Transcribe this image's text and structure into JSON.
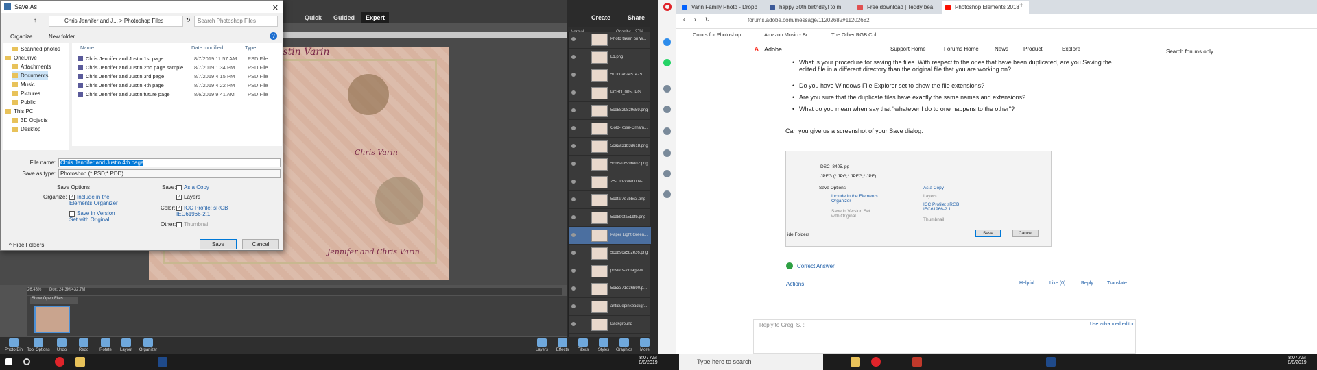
{
  "pse": {
    "modes": [
      "Quick",
      "Guided",
      "Expert"
    ],
    "create_label": "Create",
    "share_label": "Share",
    "doc_titles": [
      "and Justin Varin",
      "Chris Varin",
      "Jennifer and Chris Varin"
    ],
    "zoom_status": "26.43%",
    "doc_size": "Doc: 24.3M/432.7M",
    "show_open_files": "Show Open Files",
    "opacity_label": "Opacity:",
    "opacity_value": "37%",
    "blend_mode": "Normal",
    "bottom_tools": [
      "Photo Bin",
      "Tool Options",
      "Undo",
      "Redo",
      "Rotate",
      "Layout",
      "Organizer"
    ],
    "bottom_right": [
      "Layers",
      "Effects",
      "Filters",
      "Styles",
      "Graphics",
      "More"
    ],
    "layers": [
      {
        "name": "Photo taken on W..."
      },
      {
        "name": "L1.png"
      },
      {
        "name": "5f1fcdac2451475..."
      },
      {
        "name": "PCHO_005.JPG"
      },
      {
        "name": "5c95829829c59.png"
      },
      {
        "name": "Gold-Rose-Ornam..."
      },
      {
        "name": "5ca2a31b3d618.png"
      },
      {
        "name": "5cd8a089968d2.png"
      },
      {
        "name": "25-Old-Valentine-..."
      },
      {
        "name": "5cdfaf7e7bbc3.png"
      },
      {
        "name": "5cd8b0fa51bfb.png"
      },
      {
        "name": "Paper Light Green..."
      },
      {
        "name": "5cd89ca5b2e36.png"
      },
      {
        "name": "posters-vintage-w..."
      },
      {
        "name": "5c53371d36b90.p..."
      },
      {
        "name": "antiquepinkbackgr..."
      },
      {
        "name": "Background"
      }
    ]
  },
  "dialog": {
    "title": "Save As",
    "path": "Chris Jennifer and J...  >  Photoshop Files",
    "search_placeholder": "Search Photoshop Files",
    "organize": "Organize",
    "new_folder": "New folder",
    "tree": [
      "Scanned photos",
      "OneDrive",
      "Attachments",
      "Documents",
      "Music",
      "Pictures",
      "Public",
      "This PC",
      "3D Objects",
      "Desktop"
    ],
    "columns": [
      "Name",
      "Date modified",
      "Type"
    ],
    "files": [
      {
        "name": "Chris Jennifer and Justin 1st page",
        "date": "8/7/2019 11:57 AM",
        "type": "PSD File"
      },
      {
        "name": "Chris Jennifer and Justin 2nd page sample",
        "date": "8/7/2019 1:34 PM",
        "type": "PSD File"
      },
      {
        "name": "Chris Jennifer and Justin 3rd page",
        "date": "8/7/2019 4:15 PM",
        "type": "PSD File"
      },
      {
        "name": "Chris Jennifer and Justin 4th page",
        "date": "8/7/2019 4:22 PM",
        "type": "PSD File"
      },
      {
        "name": "Chris Jennifer and Justin future page",
        "date": "8/6/2019 9:41 AM",
        "type": "PSD File"
      }
    ],
    "file_name_label": "File name:",
    "file_name_value": "Chris Jennifer and Justin 4th page",
    "save_type_label": "Save as type:",
    "save_type_value": "Photoshop (*.PSD;*.PDD)",
    "save_options": "Save Options",
    "organize_label": "Organize:",
    "include_elements": "Include in the Elements Organizer",
    "save_version_set": "Save in Version Set with Original",
    "save_label": "Save:",
    "as_copy": "As a Copy",
    "layers_opt": "Layers",
    "color_label": "Color:",
    "icc_profile": "ICC Profile:  sRGB IEC61966-2.1",
    "other_label": "Other:",
    "thumbnail": "Thumbnail",
    "hide_folders": "Hide Folders",
    "save_btn": "Save",
    "cancel_btn": "Cancel"
  },
  "browser": {
    "tabs": [
      "Varin Family Photo - Dropb",
      "happy 30th birthday! to m",
      "Free download | Teddy bea",
      "Photoshop Elements 2018"
    ],
    "url": "forums.adobe.com/message/11202682#11202682",
    "bookmarks": [
      "Colors for Photoshop",
      "Amazon Music - Br...",
      "The Other RGB Col..."
    ],
    "brand": "Adobe",
    "nav": [
      "Support Home",
      "Forums Home",
      "News",
      "Product",
      "Explore"
    ],
    "search_label": "Search forums only",
    "post_lines": [
      "What is your procedure for saving the files.  With respect to the ones that have been duplicated, are you Saving the edited file in a different directory than the original file that you are working on?",
      "Do you have Windows File Explorer set to show the file extensions?",
      "Are you sure that the duplicate files have exactly the same names and extensions?",
      "What do you mean when say that \"whatever I do to one happens to the other\"?"
    ],
    "screenshot_req": "Can you give us a screenshot of your Save dialog:",
    "shot": {
      "file_name": "DSC_8405.jpg",
      "save_type": "JPEG (*.JPG;*.JPEG;*.JPE)",
      "save_options": "Save Options",
      "include": "Include in the Elements Organizer",
      "version_set": "Save in Version Set with Original",
      "as_copy": "As a Copy",
      "layers": "Layers",
      "icc": "ICC Profile:  sRGB IEC61966-2.1",
      "thumbnail": "Thumbnail",
      "hide_folders": "ide Folders",
      "save": "Save",
      "cancel": "Cancel"
    },
    "correct_answer": "Correct Answer",
    "actions": "Actions",
    "helpful": "Helpful",
    "like": "Like (0)",
    "reply": "Reply",
    "translate": "Translate",
    "reply_to": "Reply to Greg_S. :",
    "use_advanced": "Use advanced editor"
  },
  "taskbar": {
    "search_placeholder": "Type here to search",
    "time": "8:07 AM",
    "date": "8/8/2019"
  }
}
